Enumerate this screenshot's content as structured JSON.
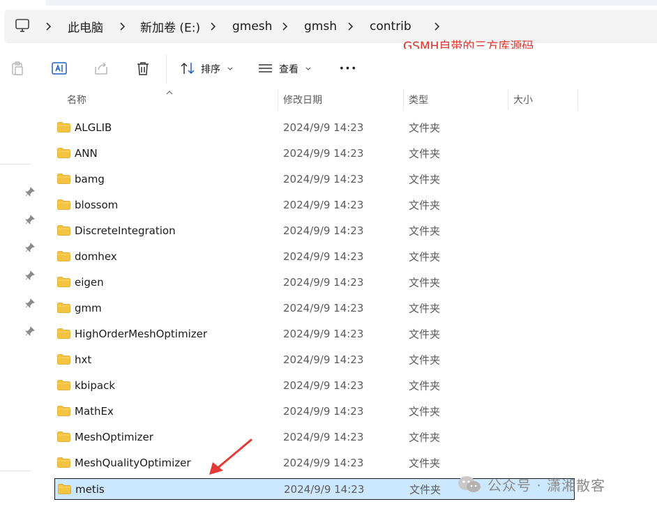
{
  "addressbar": {
    "crumbs": [
      "此电脑",
      "新加卷 (E:)",
      "gmesh",
      "gmsh",
      "contrib"
    ]
  },
  "annotation": {
    "text": "GSMH自带的三方库源码",
    "color": "#e0302a"
  },
  "toolbar": {
    "sort_label": "排序",
    "view_label": "查看",
    "more_label": "•••"
  },
  "columns": {
    "name": "名称",
    "date": "修改日期",
    "type": "类型",
    "size": "大小"
  },
  "files": [
    {
      "name": "ALGLIB",
      "date": "2024/9/9 14:23",
      "type": "文件夹"
    },
    {
      "name": "ANN",
      "date": "2024/9/9 14:23",
      "type": "文件夹"
    },
    {
      "name": "bamg",
      "date": "2024/9/9 14:23",
      "type": "文件夹"
    },
    {
      "name": "blossom",
      "date": "2024/9/9 14:23",
      "type": "文件夹"
    },
    {
      "name": "DiscreteIntegration",
      "date": "2024/9/9 14:23",
      "type": "文件夹"
    },
    {
      "name": "domhex",
      "date": "2024/9/9 14:23",
      "type": "文件夹"
    },
    {
      "name": "eigen",
      "date": "2024/9/9 14:23",
      "type": "文件夹"
    },
    {
      "name": "gmm",
      "date": "2024/9/9 14:23",
      "type": "文件夹"
    },
    {
      "name": "HighOrderMeshOptimizer",
      "date": "2024/9/9 14:23",
      "type": "文件夹"
    },
    {
      "name": "hxt",
      "date": "2024/9/9 14:23",
      "type": "文件夹"
    },
    {
      "name": "kbipack",
      "date": "2024/9/9 14:23",
      "type": "文件夹"
    },
    {
      "name": "MathEx",
      "date": "2024/9/9 14:23",
      "type": "文件夹"
    },
    {
      "name": "MeshOptimizer",
      "date": "2024/9/9 14:23",
      "type": "文件夹"
    },
    {
      "name": "MeshQualityOptimizer",
      "date": "2024/9/9 14:23",
      "type": "文件夹"
    },
    {
      "name": "metis",
      "date": "2024/9/9 14:23",
      "type": "文件夹",
      "selected": true
    }
  ],
  "watermark": {
    "text": "公众号 · 潇湘散客"
  },
  "colors": {
    "folder": "#f5c342",
    "selection": "#cce8ff",
    "arrow": "#e53935"
  }
}
